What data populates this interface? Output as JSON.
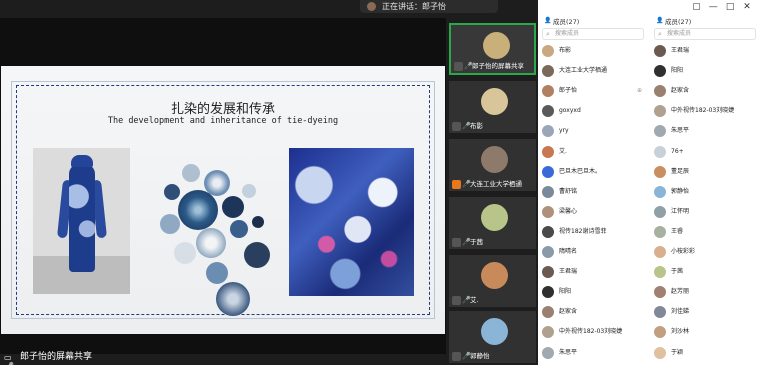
{
  "meeting": {
    "speaking_banner": "正在讲话：郎子怡",
    "share_label": "郎子怡的屏幕共享"
  },
  "slide": {
    "title": "扎染的发展和传承",
    "subtitle": "The development and inheritance of tie-dyeing"
  },
  "tiles": [
    {
      "label": "郎子怡的屏幕共享",
      "avatar_color": "#c9b07a",
      "active": true
    },
    {
      "label": "布影",
      "avatar_color": "#d9c59a"
    },
    {
      "label": "大连工业大学栖通",
      "avatar_color": "#8e7a6a"
    },
    {
      "label": "于茜",
      "avatar_color": "#b7c58a"
    },
    {
      "label": "艾.",
      "avatar_color": "#c88a5a"
    },
    {
      "label": "郭静怡",
      "avatar_color": "#8ab5d6"
    }
  ],
  "panel": {
    "left_header": "成员(27)",
    "right_header": "成员(27)",
    "search_placeholder": "搜索成员",
    "window_controls": [
      "▢",
      "—",
      "□",
      "✕"
    ],
    "left_members": [
      {
        "name": "布影",
        "color": "#c8a880"
      },
      {
        "name": "大连工业大学栖通",
        "color": "#7a6a5a"
      },
      {
        "name": "郎子怡",
        "color": "#b08060",
        "badge": "⊕"
      },
      {
        "name": "goxyxd",
        "color": "#5a5a5a"
      },
      {
        "name": "yry",
        "color": "#9aa6b8"
      },
      {
        "name": "艾.",
        "color": "#c87850"
      },
      {
        "name": "巴旦木巴旦木。",
        "color": "#3a6ad8"
      },
      {
        "name": "曹舒铭",
        "color": "#7a8a9a"
      },
      {
        "name": "梁馨心",
        "color": "#b0907a"
      },
      {
        "name": "视传182谢诗雪菲",
        "color": "#4a4a4a"
      },
      {
        "name": "隋晴名",
        "color": "#8a9aa8"
      },
      {
        "name": "王君瑞",
        "color": "#6a5a50"
      },
      {
        "name": "阳阳",
        "color": "#303030"
      },
      {
        "name": "赵家含",
        "color": "#9a8070"
      },
      {
        "name": "中外视传182-03刘晓婕",
        "color": "#b0a090"
      },
      {
        "name": "朱思平",
        "color": "#a0a8b0"
      }
    ],
    "right_members": [
      {
        "name": "王君瑞",
        "color": "#6a5a50"
      },
      {
        "name": "阳阳",
        "color": "#303030"
      },
      {
        "name": "赵家含",
        "color": "#9a8070"
      },
      {
        "name": "中外视传182-03刘晓婕",
        "color": "#b0a090"
      },
      {
        "name": "朱思平",
        "color": "#a0a8b0"
      },
      {
        "name": "76+",
        "color": "#c8d0d8"
      },
      {
        "name": "董足辰",
        "color": "#c89060"
      },
      {
        "name": "郭静怡",
        "color": "#8ab5d6"
      },
      {
        "name": "江怀明",
        "color": "#90a0a8"
      },
      {
        "name": "王睿",
        "color": "#a8b0a0"
      },
      {
        "name": "小桉彩彩",
        "color": "#d8b090"
      },
      {
        "name": "于茜",
        "color": "#b7c58a"
      },
      {
        "name": "赵芳丽",
        "color": "#a08070"
      },
      {
        "name": "刘佳娣",
        "color": "#80889a"
      },
      {
        "name": "刘沙林",
        "color": "#c0a080"
      },
      {
        "name": "于颖",
        "color": "#e0c0a0"
      }
    ]
  }
}
